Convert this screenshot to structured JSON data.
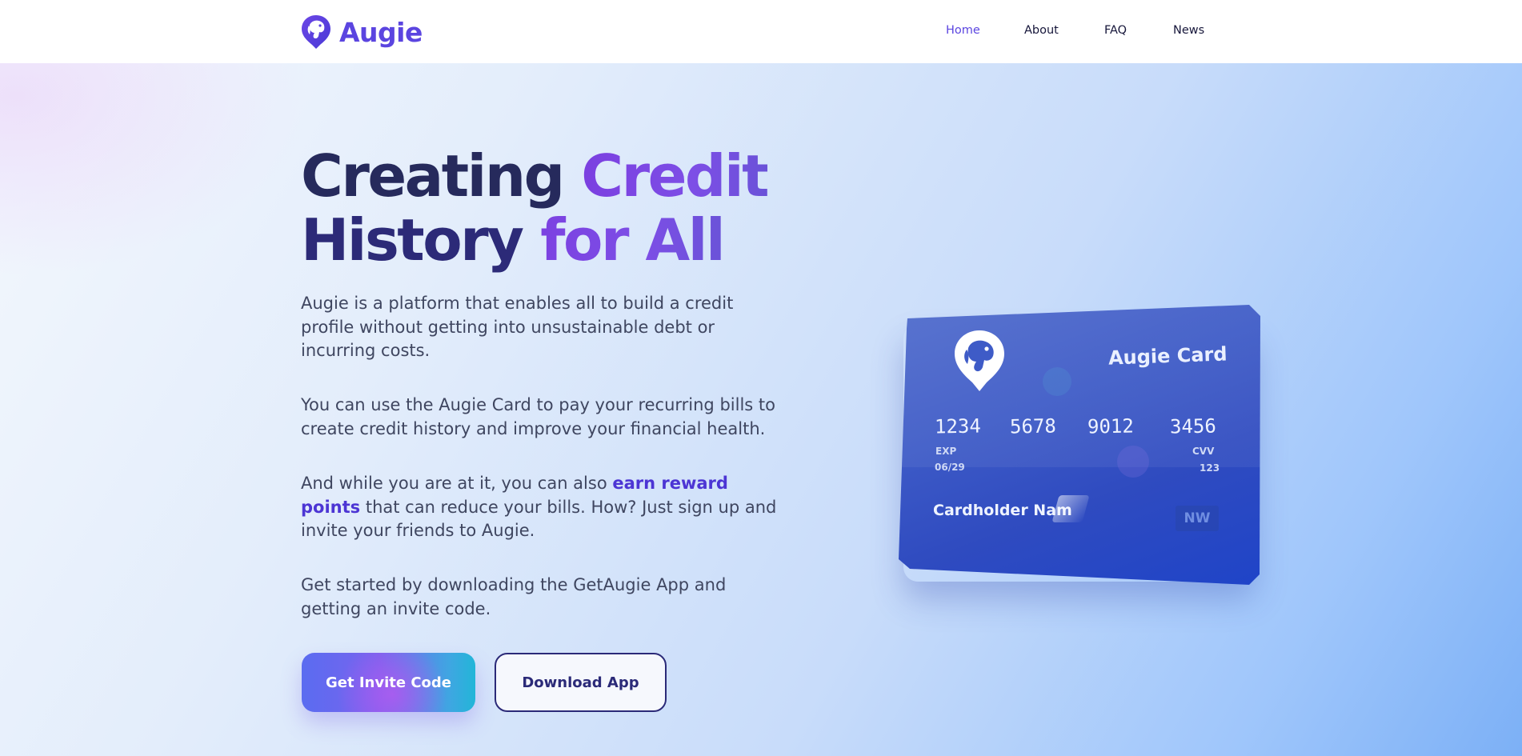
{
  "brand": {
    "name": "Augie",
    "accent_color": "#5b45e0",
    "logo_icon": "dog-head-icon"
  },
  "nav": {
    "items": [
      {
        "label": "Home",
        "active": true
      },
      {
        "label": "About",
        "active": false
      },
      {
        "label": "FAQ",
        "active": false
      },
      {
        "label": "News",
        "active": false
      }
    ]
  },
  "hero": {
    "headline": {
      "part1": "Creating ",
      "part2": "Credit",
      "part3": "History",
      "part4": " for All"
    },
    "paragraphs": {
      "p1": "Augie is a platform that enables all to build a credit profile without getting into unsustainable debt or incurring costs.",
      "p2": "You can use the Augie Card to pay your recurring bills to create credit history and improve your financial health.",
      "p3_before": "And while you are at it, you can also ",
      "p3_highlight": "earn reward points",
      "p3_after": " that can reduce your bills. How? Just sign up and invite your friends to Augie.",
      "p4": "Get started by downloading the GetAugie App and getting an invite code."
    },
    "buttons": {
      "primary": "Get Invite Code",
      "secondary": "Download App"
    }
  },
  "card": {
    "title": "Augie Card",
    "number_groups": [
      "1234",
      "5678",
      "9012",
      "3456"
    ],
    "exp_label": "EXP",
    "exp_value": "06/29",
    "cvv_label": "CVV",
    "cvv_value": "123",
    "holder": "Cardholder Nam",
    "badge": "NW",
    "logo_icon": "dog-head-icon"
  }
}
